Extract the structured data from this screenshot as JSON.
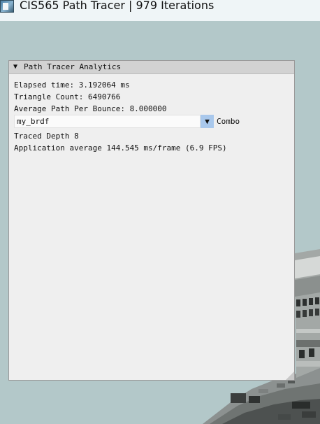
{
  "window": {
    "title": "CIS565 Path Tracer | 979 Iterations",
    "icon": "app-window-icon"
  },
  "panel": {
    "title": "Path Tracer Analytics",
    "collapse_glyph": "▼",
    "elapsed_time": "Elapsed time: 3.192064 ms",
    "triangle_count": "Triangle Count: 6490766",
    "avg_path_per_bounce": "Average Path Per Bounce: 8.000000",
    "combo": {
      "value": "my_brdf",
      "arrow_glyph": "▼",
      "label": "Combo"
    },
    "traced_depth": "Traced Depth 8",
    "app_average": "Application average 144.545 ms/frame (6.9 FPS)"
  },
  "colors": {
    "background": "#b3c8c9",
    "titlebar": "#eff5f7",
    "panel_bg": "#efefef",
    "panel_title_bg": "#d2d2d2",
    "combo_arrow": "#a9c8ec"
  }
}
